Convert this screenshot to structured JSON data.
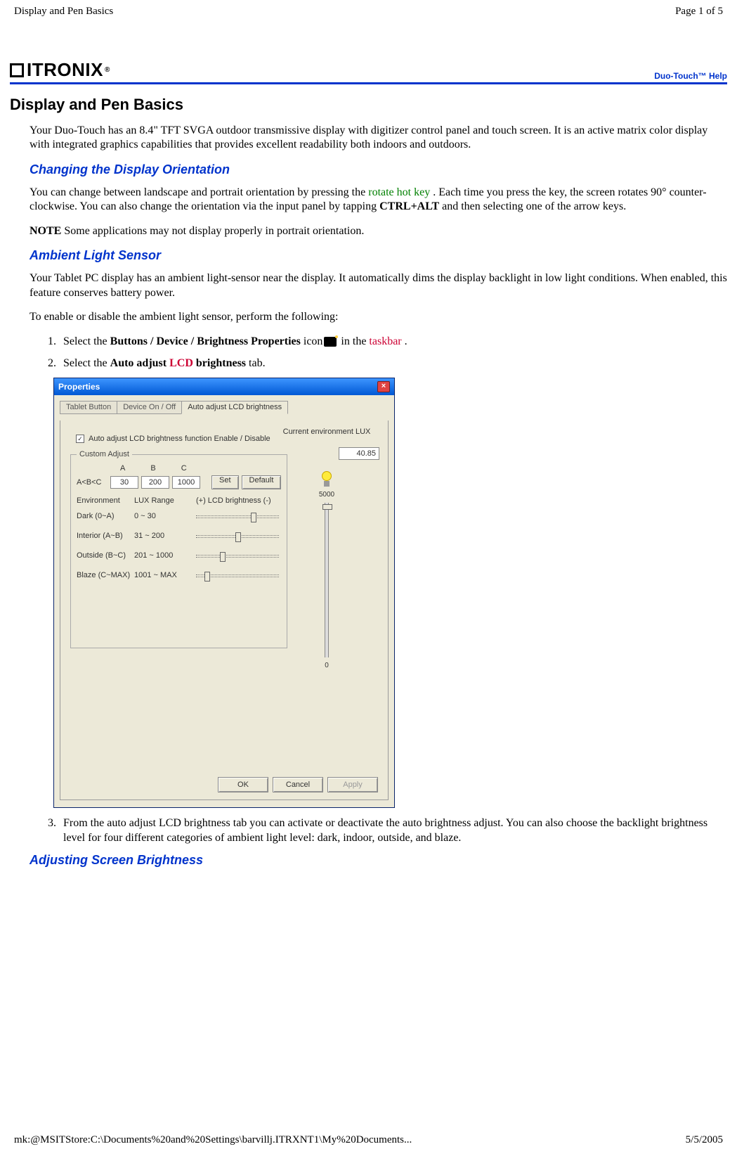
{
  "header": {
    "left": "Display and Pen Basics",
    "right": "Page 1 of 5"
  },
  "footer": {
    "left": "mk:@MSITStore:C:\\Documents%20and%20Settings\\barvillj.ITRXNT1\\My%20Documents...",
    "right": "5/5/2005"
  },
  "brand": {
    "logo_text": "ITRONIX",
    "reg": "®",
    "help_link": "Duo-Touch™ Help"
  },
  "title": "Display and Pen Basics",
  "intro": "Your Duo-Touch has an 8.4\" TFT SVGA outdoor transmissive display with digitizer control panel and touch screen. It is an active matrix color display with integrated graphics capabilities that provides excellent readability both indoors and outdoors.",
  "orientation": {
    "heading": "Changing the Display Orientation",
    "pre": "You can change between landscape and portrait orientation by pressing the ",
    "link": "rotate hot key",
    "mid": " . Each time you press the key, the screen rotates 90° counter-clockwise. You can also change the orientation via the input panel by tapping ",
    "kbd": "CTRL+ALT",
    "post": " and then selecting one of the arrow keys.",
    "note_label": "NOTE",
    "note_text": "  Some applications may not display properly in portrait orientation."
  },
  "ambient": {
    "heading": "Ambient Light Sensor",
    "p1": "Your Tablet PC display has an ambient light-sensor near the display. It automatically dims the display backlight in low light conditions. When enabled, this feature conserves battery power.",
    "p2": "To enable or disable the ambient light sensor, perform the following:",
    "steps": {
      "s1_pre": "Select the ",
      "s1_bold": "Buttons / Device / Brightness Properties",
      "s1_mid": " icon",
      "s1_post_pre": "  in the ",
      "s1_taskbar": "taskbar",
      "s1_end": " .",
      "s2_pre": "Select the ",
      "s2_b1": "Auto adjust ",
      "s2_lcd": "LCD",
      "s2_b2": " brightness",
      "s2_post": " tab.",
      "s3": "From the auto adjust LCD brightness tab you can activate or deactivate the auto brightness adjust. You can also choose the backlight brightness level for four different categories of ambient light level: dark, indoor, outside, and blaze."
    }
  },
  "brightness_heading": "Adjusting Screen Brightness",
  "dialog": {
    "title": "Properties",
    "tabs": {
      "t1": "Tablet Button",
      "t2": "Device On / Off",
      "t3": "Auto adjust LCD brightness"
    },
    "checkbox": "Auto adjust LCD brightness function Enable / Disable",
    "fieldset_legend": "Custom Adjust",
    "abc": {
      "a": "A",
      "b": "B",
      "c": "C"
    },
    "abc_left": "A<B<C",
    "vals": {
      "a": "30",
      "b": "200",
      "c": "1000"
    },
    "btn_set": "Set",
    "btn_default": "Default",
    "hdr_env": "Environment",
    "hdr_range": "LUX Range",
    "hdr_bright": "(+) LCD brightness (-)",
    "rows": [
      {
        "env": "Dark (0~A)",
        "range": "0 ~ 30",
        "thumb": 78
      },
      {
        "env": "Interior (A~B)",
        "range": "31 ~ 200",
        "thumb": 56
      },
      {
        "env": "Outside (B~C)",
        "range": "201 ~ 1000",
        "thumb": 34
      },
      {
        "env": "Blaze (C~MAX)",
        "range": "1001 ~ MAX",
        "thumb": 12
      }
    ],
    "right": {
      "lux_label": "Current environment LUX",
      "lux_val": "40.85",
      "max": "5000",
      "min": "0"
    },
    "buttons": {
      "ok": "OK",
      "cancel": "Cancel",
      "apply": "Apply"
    }
  }
}
